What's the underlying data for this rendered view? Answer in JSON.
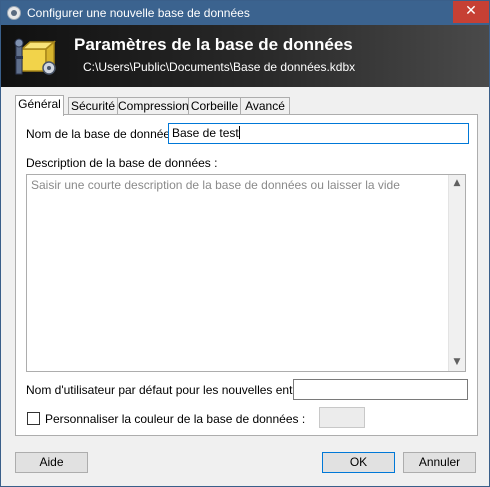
{
  "window": {
    "title": "Configurer une nouvelle base de données",
    "close_glyph": "✕",
    "app_icon": "keepass-lock-icon"
  },
  "banner": {
    "heading": "Paramètres de la base de données",
    "path": "C:\\Users\\Public\\Documents\\Base de données.kdbx",
    "icon": "database-settings-icon"
  },
  "tabs": [
    {
      "label": "Général",
      "active": true
    },
    {
      "label": "Sécurité",
      "active": false
    },
    {
      "label": "Compression",
      "active": false
    },
    {
      "label": "Corbeille",
      "active": false
    },
    {
      "label": "Avancé",
      "active": false
    }
  ],
  "general": {
    "name_label": "Nom de la base de données :",
    "name_value": "Base de test",
    "description_label": "Description de la base de données :",
    "description_placeholder": "Saisir une courte description de la base de données ou laisser la vide",
    "default_user_label": "Nom d'utilisateur par défaut pour les nouvelles entrées :",
    "default_user_value": "",
    "custom_color_label": "Personnaliser la couleur de la base de données :",
    "custom_color_checked": false
  },
  "scrollbar": {
    "up": "▲",
    "down": "▼"
  },
  "buttons": {
    "help": "Aide",
    "ok": "OK",
    "cancel": "Annuler"
  },
  "colors": {
    "titlebar": "#3b638f",
    "close": "#c64034",
    "focus": "#0078d7"
  }
}
